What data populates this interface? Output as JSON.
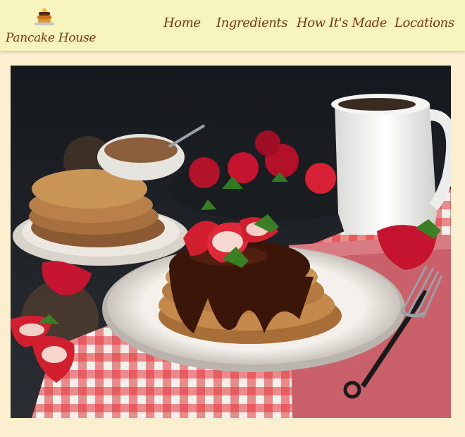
{
  "brand": {
    "name": "Pancake House",
    "logo_icon": "pancake-stack-icon"
  },
  "nav": {
    "items": [
      {
        "label": "Home"
      },
      {
        "label": "Ingredients"
      },
      {
        "label": "How It's Made"
      },
      {
        "label": "Locations"
      }
    ]
  },
  "colors": {
    "header_bg": "#f7f4bd",
    "page_bg": "#fbefd0",
    "brand_text": "#7a3616"
  }
}
